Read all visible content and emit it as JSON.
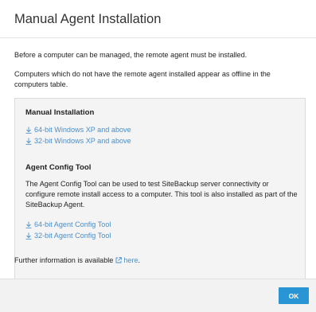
{
  "dialog": {
    "title": "Manual Agent Installation",
    "intro_1": "Before a computer can be managed, the remote agent must be installed.",
    "intro_2": "Computers which do not have the remote agent installed appear as offline in the computers table."
  },
  "manual_installation": {
    "title": "Manual Installation",
    "links": [
      {
        "label": "64-bit Windows XP and above",
        "icon": "download-icon"
      },
      {
        "label": "32-bit Windows XP and above",
        "icon": "download-icon"
      }
    ]
  },
  "agent_config_tool": {
    "title": "Agent Config Tool",
    "description": "The Agent Config Tool can be used to test SiteBackup server connectivity or configure remote install access to a computer. This tool is also installed as part of the SiteBackup Agent.",
    "links": [
      {
        "label": "64-bit Agent Config Tool",
        "icon": "download-icon"
      },
      {
        "label": "32-bit Agent Config Tool",
        "icon": "download-icon"
      }
    ]
  },
  "footer": {
    "further_info": "Further information is available",
    "here_link": "here",
    "here_suffix": ".",
    "here_icon": "external-link-icon"
  },
  "buttons": {
    "ok_label": "OK"
  },
  "colors": {
    "link": "#4a8fcb",
    "primary_button": "#2a95d5",
    "panel_background": "#f4f4f4"
  }
}
